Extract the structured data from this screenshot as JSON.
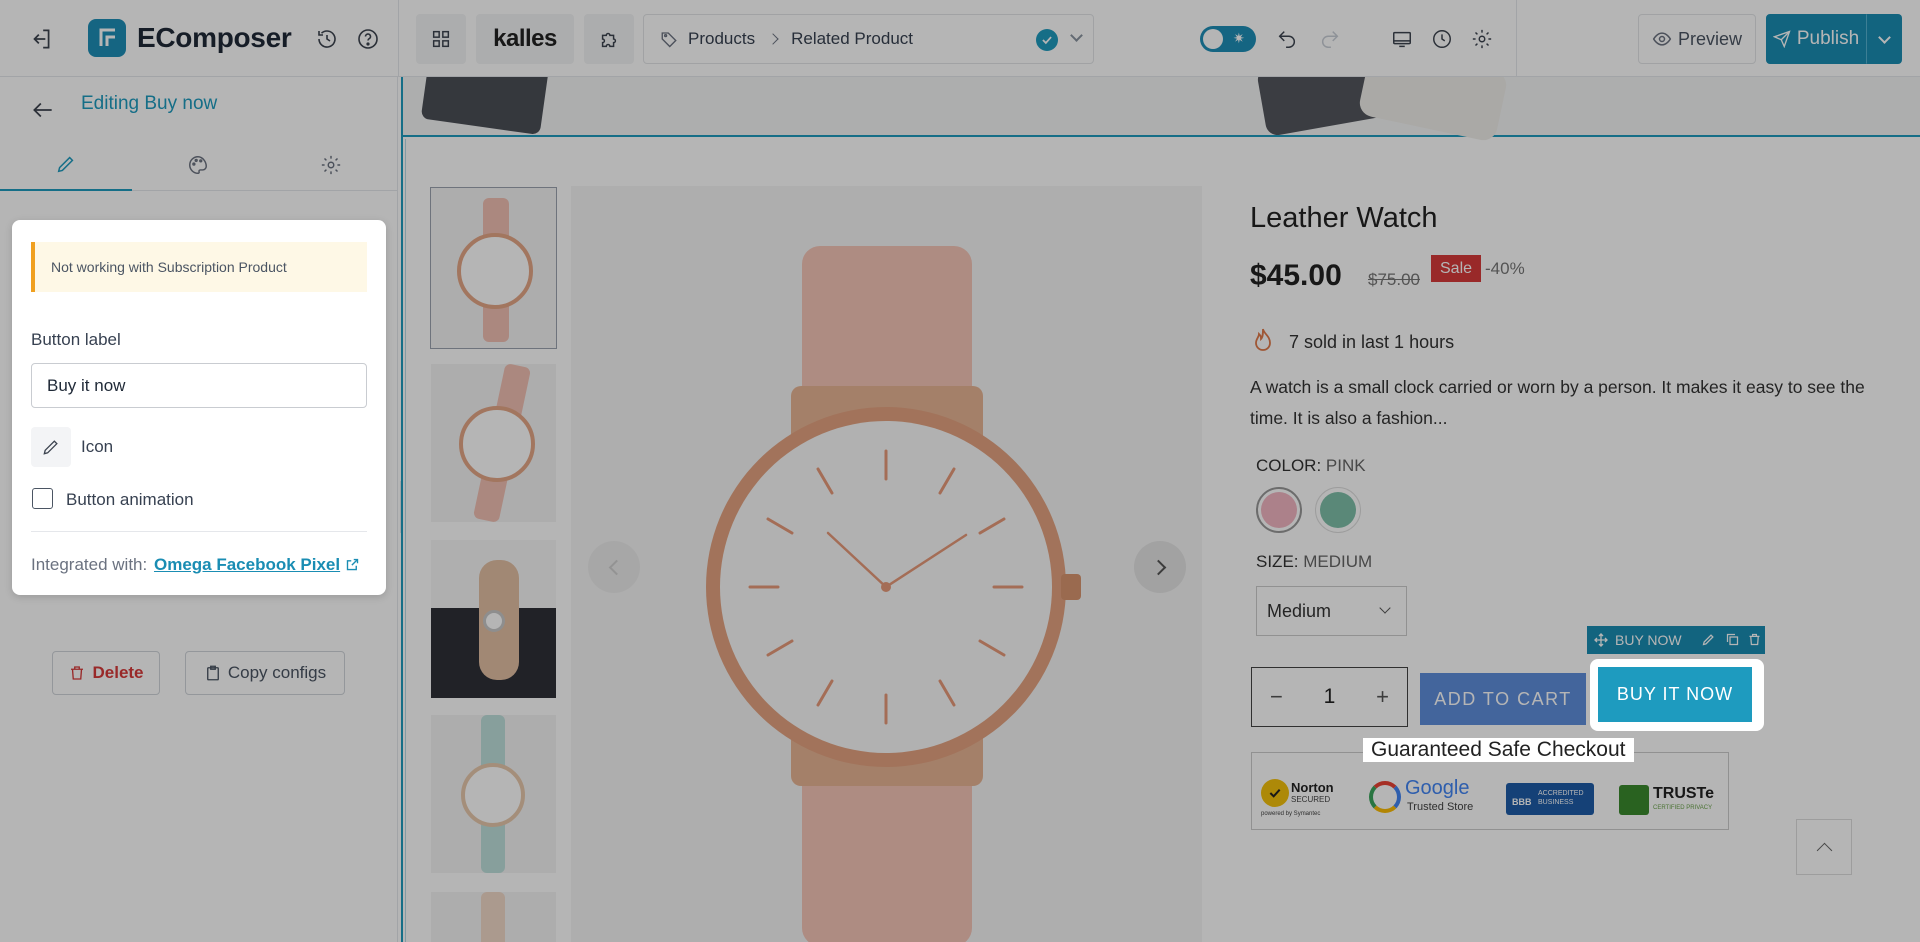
{
  "topbar": {
    "brand": "EComposer",
    "store_logo": "kalles",
    "breadcrumb": [
      "Products",
      "Related Product"
    ],
    "preview_label": "Preview",
    "publish_label": "Publish"
  },
  "left_panel": {
    "title": "Editing Buy now",
    "tabs": [
      "edit-tab",
      "style-tab",
      "settings-tab"
    ],
    "delete_label": "Delete",
    "copy_label": "Copy configs"
  },
  "settings_card": {
    "notice": "Not working with Subscription Product",
    "button_label_heading": "Button label",
    "button_label_value": "Buy it now",
    "icon_label": "Icon",
    "animation_label": "Button animation",
    "integrated_prefix": "Integrated with:",
    "integrated_link": "Omega Facebook Pixel"
  },
  "product": {
    "title": "Leather Watch",
    "price": "$45.00",
    "compare_price": "$75.00",
    "sale_badge": "Sale",
    "discount": "-40%",
    "sold_text": "7 sold in last 1 hours",
    "description": "A watch is a small clock carried or worn by a person. It makes it easy to see the time. It is also a fashion...",
    "color_label": "COLOR:",
    "color_value": "PINK",
    "size_label": "SIZE:",
    "size_value": "MEDIUM",
    "size_select": "Medium",
    "quantity": "1",
    "add_to_cart": "ADD TO CART",
    "buy_now": "BUY IT NOW",
    "buy_now_toolbar": "BUY NOW",
    "guarantee_title": "Guaranteed Safe Checkout",
    "badges": {
      "norton": "Norton",
      "norton_sub": "SECURED",
      "norton_foot": "powered by Symantec",
      "google": "Google",
      "google_sub": "Trusted Store",
      "bbb": "ACCREDITED BUSINESS",
      "bbb_mark": "BBB",
      "truste": "TRUSTe",
      "truste_sub": "CERTIFIED PRIVACY"
    }
  },
  "colors": {
    "accent": "#1e9bbf",
    "publish_bg": "#1a8db3",
    "sale_badge": "#d83a3a",
    "swatch_pink": "#f2b6c3",
    "swatch_teal": "#7fc0aa",
    "add_to_cart_bg": "#5f8fdc"
  }
}
